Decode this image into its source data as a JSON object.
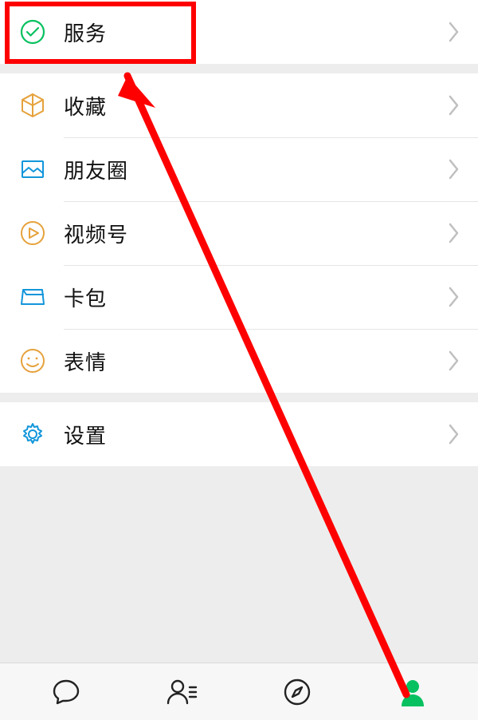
{
  "groups": [
    {
      "items": [
        {
          "key": "services",
          "label": "服务"
        }
      ]
    },
    {
      "items": [
        {
          "key": "favorites",
          "label": "收藏"
        },
        {
          "key": "moments",
          "label": "朋友圈"
        },
        {
          "key": "channels",
          "label": "视频号"
        },
        {
          "key": "cards",
          "label": "卡包"
        },
        {
          "key": "stickers",
          "label": "表情"
        }
      ]
    },
    {
      "items": [
        {
          "key": "settings",
          "label": "设置"
        }
      ]
    }
  ],
  "tabs": [
    {
      "key": "chats",
      "active": false
    },
    {
      "key": "contacts",
      "active": false
    },
    {
      "key": "discover",
      "active": false
    },
    {
      "key": "me",
      "active": true
    }
  ],
  "colors": {
    "accent": "#07c160",
    "highlight": "#ff0000"
  }
}
